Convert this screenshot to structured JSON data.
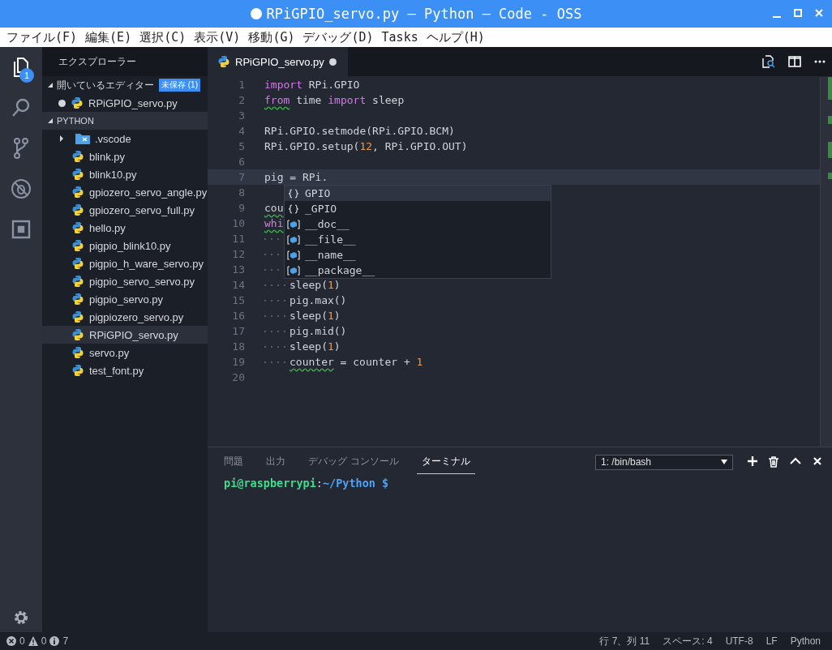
{
  "window": {
    "title": "RPiGPIO_servo.py — Python — Code - OSS",
    "modified": true
  },
  "menu": [
    "ファイル(F)",
    "編集(E)",
    "選択(C)",
    "表示(V)",
    "移動(G)",
    "デバッグ(D)",
    "Tasks",
    "ヘルプ(H)"
  ],
  "activity_bar": {
    "items": [
      {
        "kind": "files",
        "selected": true,
        "badge": "1"
      },
      {
        "kind": "search",
        "selected": false
      },
      {
        "kind": "scm",
        "selected": false
      },
      {
        "kind": "debug",
        "selected": false
      },
      {
        "kind": "extensions",
        "selected": false
      }
    ]
  },
  "sidebar": {
    "title": "エクスプローラー",
    "open_editors": {
      "label": "開いているエディター",
      "badge": "未保存 (1)",
      "expanded": true,
      "items": [
        {
          "name": "RPiGPIO_servo.py",
          "modified": true
        }
      ]
    },
    "folder": {
      "label": "PYTHON",
      "expanded": true,
      "items": [
        {
          "name": ".vscode",
          "kind": "folder",
          "expanded": false,
          "selected": false
        },
        {
          "name": "blink.py",
          "kind": "python",
          "selected": false
        },
        {
          "name": "blink10.py",
          "kind": "python",
          "selected": false
        },
        {
          "name": "gpiozero_servo_angle.py",
          "kind": "python",
          "selected": false
        },
        {
          "name": "gpiozero_servo_full.py",
          "kind": "python",
          "selected": false
        },
        {
          "name": "hello.py",
          "kind": "python",
          "selected": false
        },
        {
          "name": "pigpio_blink10.py",
          "kind": "python",
          "selected": false
        },
        {
          "name": "pigpio_h_ware_servo.py",
          "kind": "python",
          "selected": false
        },
        {
          "name": "pigpio_servo_servo.py",
          "kind": "python",
          "selected": false
        },
        {
          "name": "pigpio_servo.py",
          "kind": "python",
          "selected": false
        },
        {
          "name": "pigpiozero_servo.py",
          "kind": "python",
          "selected": false
        },
        {
          "name": "RPiGPIO_servo.py",
          "kind": "python",
          "selected": true
        },
        {
          "name": "servo.py",
          "kind": "python",
          "selected": false
        },
        {
          "name": "test_font.py",
          "kind": "python",
          "selected": false
        }
      ]
    }
  },
  "editor": {
    "tabs": [
      {
        "label": "RPiGPIO_servo.py",
        "selected": true,
        "modified": true
      }
    ],
    "lines": [
      {
        "number": "1",
        "current": false,
        "indent": false,
        "tokens": [
          {
            "kind": "keyword",
            "text": "import"
          },
          {
            "kind": "plain",
            "text": " RPi.GPIO"
          }
        ]
      },
      {
        "number": "2",
        "current": false,
        "indent": false,
        "tokens": [
          {
            "kind": "keyword",
            "text": "from",
            "warning": true
          },
          {
            "kind": "plain",
            "text": " time "
          },
          {
            "kind": "keyword",
            "text": "import"
          },
          {
            "kind": "plain",
            "text": " sleep"
          }
        ]
      },
      {
        "number": "3",
        "current": false,
        "indent": false
      },
      {
        "number": "4",
        "current": false,
        "indent": false,
        "tokens": [
          {
            "kind": "plain",
            "text": "RPi.GPIO.setmode(RPi.GPIO.BCM)"
          }
        ]
      },
      {
        "number": "5",
        "current": false,
        "indent": false,
        "tokens": [
          {
            "kind": "plain",
            "text": "RPi.GPIO.setup("
          },
          {
            "kind": "number",
            "text": "12"
          },
          {
            "kind": "plain",
            "text": ", RPi.GPIO.OUT)"
          }
        ]
      },
      {
        "number": "6",
        "current": false,
        "indent": false
      },
      {
        "number": "7",
        "current": true,
        "indent": false,
        "tokens": [
          {
            "kind": "plain",
            "text": "pig = RPi."
          }
        ]
      },
      {
        "number": "8",
        "current": false,
        "indent": false
      },
      {
        "number": "9",
        "current": false,
        "indent": false,
        "tokens": [
          {
            "kind": "plain",
            "text": "cou",
            "warning": true
          }
        ]
      },
      {
        "number": "10",
        "current": false,
        "indent": false,
        "tokens": [
          {
            "kind": "keyword",
            "text": "whi",
            "warning": true
          }
        ]
      },
      {
        "number": "11",
        "current": false,
        "indent": true
      },
      {
        "number": "12",
        "current": false,
        "indent": true
      },
      {
        "number": "13",
        "current": false,
        "indent": true
      },
      {
        "number": "14",
        "current": false,
        "indent": true,
        "tokens": [
          {
            "kind": "plain",
            "text": "sleep("
          },
          {
            "kind": "number",
            "text": "1"
          },
          {
            "kind": "plain",
            "text": ")"
          }
        ]
      },
      {
        "number": "15",
        "current": false,
        "indent": true,
        "tokens": [
          {
            "kind": "plain",
            "text": "pig.max()"
          }
        ]
      },
      {
        "number": "16",
        "current": false,
        "indent": true,
        "tokens": [
          {
            "kind": "plain",
            "text": "sleep("
          },
          {
            "kind": "number",
            "text": "1"
          },
          {
            "kind": "plain",
            "text": ")"
          }
        ]
      },
      {
        "number": "17",
        "current": false,
        "indent": true,
        "tokens": [
          {
            "kind": "plain",
            "text": "pig.mid()"
          }
        ]
      },
      {
        "number": "18",
        "current": false,
        "indent": true,
        "tokens": [
          {
            "kind": "plain",
            "text": "sleep("
          },
          {
            "kind": "number",
            "text": "1"
          },
          {
            "kind": "plain",
            "text": ")"
          }
        ]
      },
      {
        "number": "19",
        "current": false,
        "indent": true,
        "tokens": [
          {
            "kind": "plain",
            "text": "counter",
            "warning": true
          },
          {
            "kind": "plain",
            "text": " = counter + "
          },
          {
            "kind": "number",
            "text": "1"
          }
        ]
      },
      {
        "number": "20",
        "current": false,
        "indent": false
      }
    ],
    "suggestions": [
      {
        "kind": "module",
        "label": "GPIO",
        "selected": true
      },
      {
        "kind": "module",
        "label": "_GPIO",
        "selected": false
      },
      {
        "kind": "variable",
        "label": "__doc__",
        "selected": false
      },
      {
        "kind": "variable",
        "label": "__file__",
        "selected": false
      },
      {
        "kind": "variable",
        "label": "__name__",
        "selected": false
      },
      {
        "kind": "variable",
        "label": "__package__",
        "selected": false
      }
    ]
  },
  "panel": {
    "tabs": [
      {
        "label": "問題",
        "selected": false
      },
      {
        "label": "出力",
        "selected": false
      },
      {
        "label": "デバッグ コンソール",
        "selected": false
      },
      {
        "label": "ターミナル",
        "selected": true
      }
    ],
    "terminal_select": "1: /bin/bash",
    "prompt": {
      "user": "pi@raspberrypi",
      "separator": ":",
      "path": "~/Python $"
    }
  },
  "status_bar": {
    "errors": "0",
    "warnings": "0",
    "infos": "7",
    "position": "行 7、列 11",
    "indentation": "スペース: 4",
    "encoding": "UTF-8",
    "eol": "LF",
    "language": "Python"
  }
}
